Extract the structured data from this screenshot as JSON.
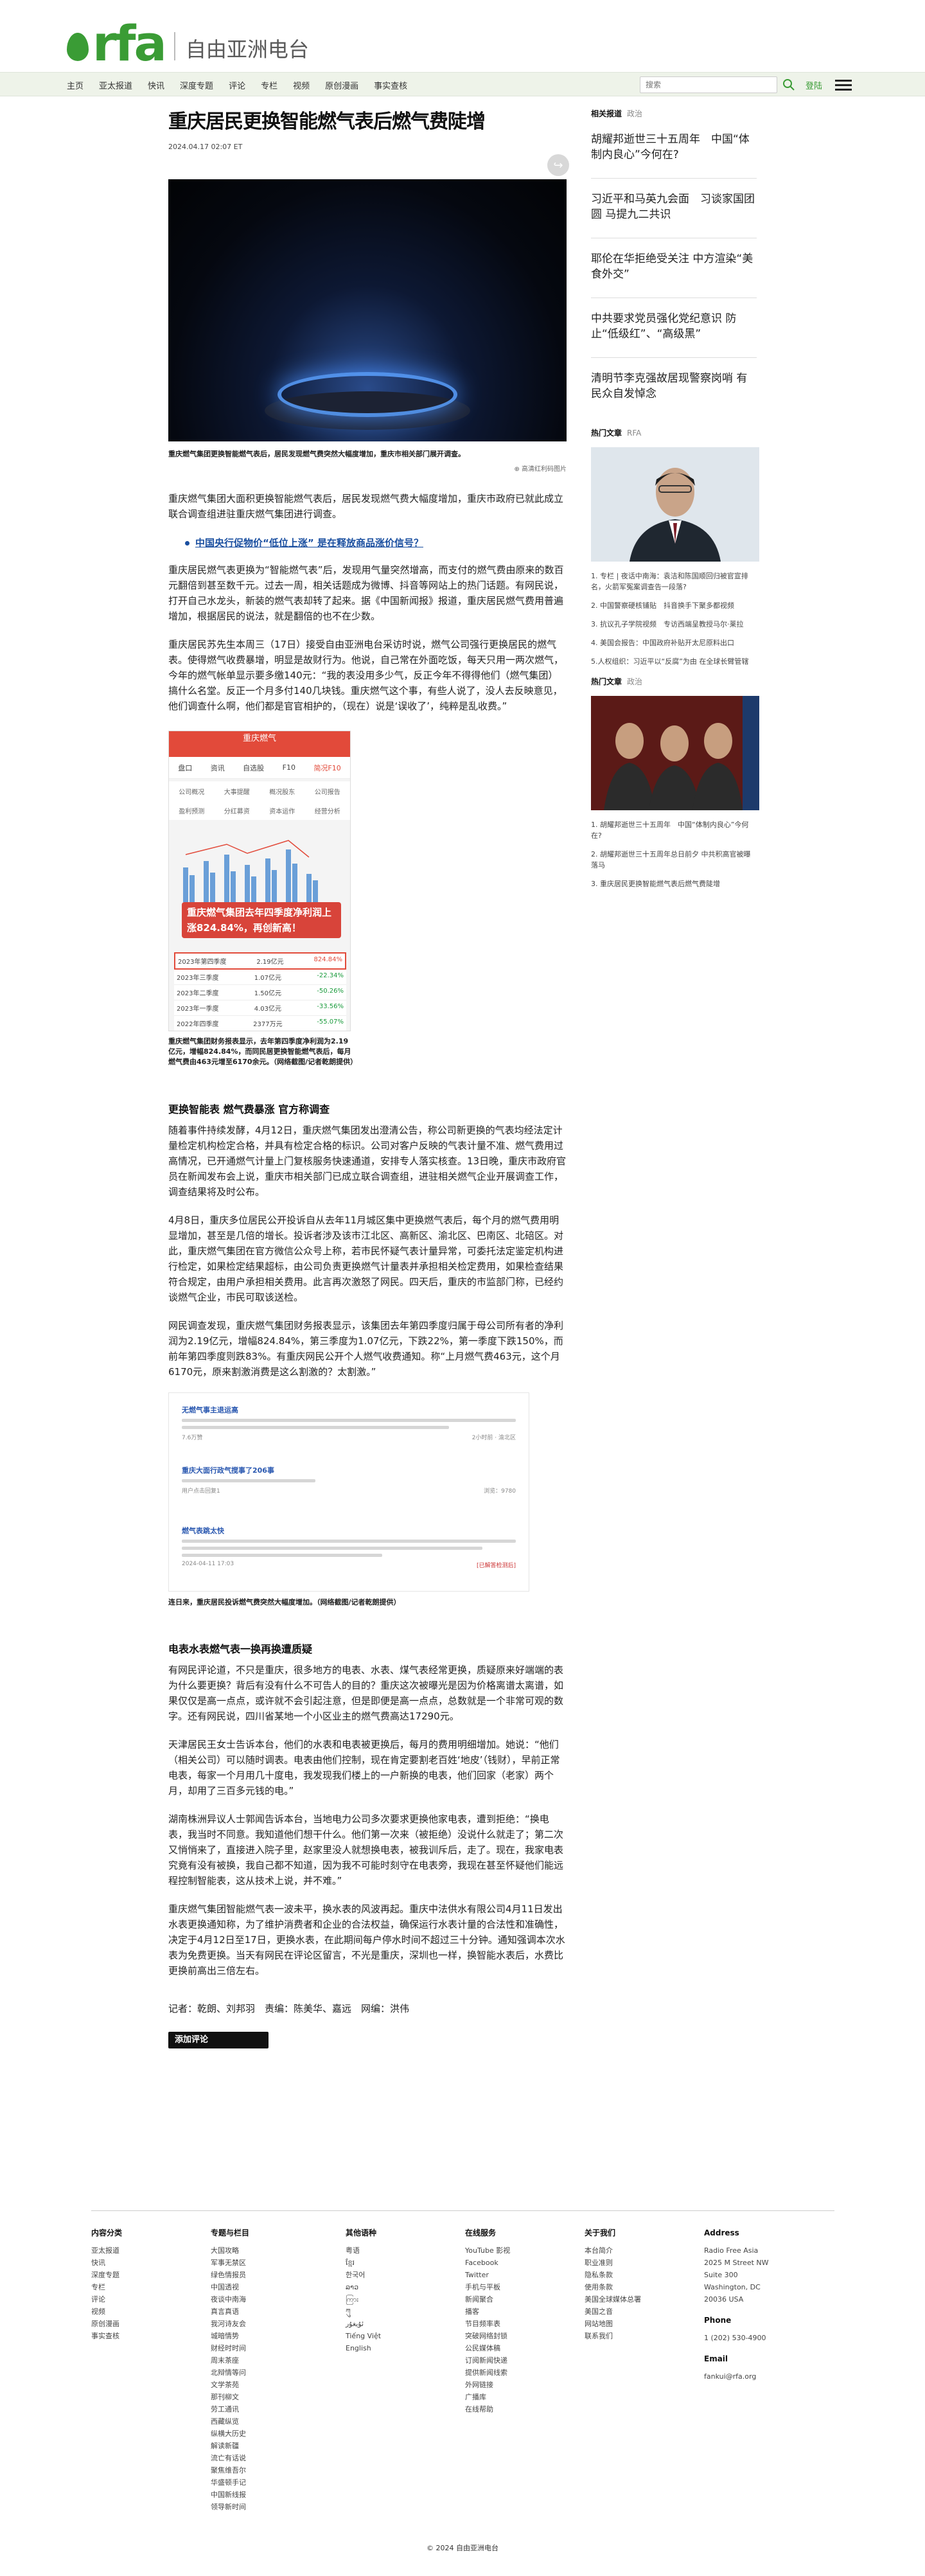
{
  "header": {
    "logo_text": "rfa",
    "logo_cn": "自由亚洲电台",
    "nav": [
      "主页",
      "亚太报道",
      "快讯",
      "深度专题",
      "评论",
      "专栏",
      "视频",
      "原创漫画",
      "事实查核"
    ],
    "search_placeholder": "搜索",
    "login": "登陆"
  },
  "article": {
    "title": "重庆居民更换智能燃气表后燃气费陡增",
    "date": "2024.04.17 02:07 ET",
    "hero_caption": "重庆燃气集团更换智能燃气表后，居民发现燃气费突然大幅度增加，重庆市相关部门展开调查。",
    "enlarge_label": "高清红利码图片",
    "p1": "重庆燃气集团大面积更换智能燃气表后，居民发现燃气费大幅度增加，重庆市政府已就此成立联合调查组进驻重庆燃气集团进行调查。",
    "related_link": "中国央行促物价“低位上涨” 是在释放商品涨价信号？",
    "p2": "重庆居民燃气表更换为“智能燃气表”后，发现用气量突然增高，而支付的燃气费由原来的数百元翻倍到甚至数千元。过去一周，相关话题成为微博、抖音等网站上的热门话题。有网民说，打开自己水龙头，新装的燃气表却转了起来。据《中国新闻报》报道，重庆居民燃气费用普遍增加，根据居民的说法，就是翻倍的也不在少数。",
    "p3": "重庆居民苏先生本周三（17日）接受自由亚洲电台采访时说，燃气公司强行更换居民的燃气表。使得燃气收费暴增，明显是故财行为。他说，自己常在外面吃饭，每天只用一两次燃气，今年的燃气帐单显示要多缴140元：“我的表没用多少气，反正今年不得得他们（燃气集团）搞什么名堂。反正一个月多付140几块钱。重庆燃气这个事，有些人说了，没人去反映意见，他们调查什么啊，他们都是官官相护的，（现在）说是‘误收了’，纯粹是乱收费。”",
    "app": {
      "header": "重庆燃气",
      "tabs": [
        "盘口",
        "资讯",
        "自选股",
        "F10",
        "简况F10"
      ],
      "grid": [
        "公司概况",
        "大事提醒",
        "概况股东",
        "公司报告",
        "盈利预测",
        "分红募资",
        "资本运作",
        "经营分析"
      ],
      "banner": "重庆燃气集团去年四季度净利润上涨824.84%，再创新高！",
      "rows": [
        {
          "label": "2023年第四季度",
          "v1": "2.19亿元",
          "v2": "824.84%"
        },
        {
          "label": "2023年三季度",
          "v1": "1.07亿元",
          "v2": "-22.34%"
        },
        {
          "label": "2023年二季度",
          "v1": "1.50亿元",
          "v2": "-50.26%"
        },
        {
          "label": "2023年一季度",
          "v1": "4.03亿元",
          "v2": "-33.56%"
        },
        {
          "label": "2022年四季度",
          "v1": "2377万元",
          "v2": "-55.07%"
        }
      ]
    },
    "app_caption": "重庆燃气集团财务报表显示，去年第四季度净利润为2.19亿元，增幅824.84%，而同民居更换智能燃气表后，每月燃气费由463元增至6170余元。（网络截图/记者乾朗提供）",
    "section1": "更换智能表 燃气费暴涨 官方称调查",
    "p4": "随着事件持续发酵，4月12日，重庆燃气集团发出澄清公告，称公司新更换的气表均经法定计量检定机构检定合格，并具有检定合格的标识。公司对客户反映的气表计量不准、燃气费用过高情况，已开通燃气计量上门复核服务快速通道，安排专人落实核查。13日晚，重庆市政府官员在新闻发布会上说，重庆市相关部门已成立联合调查组，进驻相关燃气企业开展调查工作，调查结果将及时公布。",
    "p5": "4月8日，重庆多位居民公开投诉自从去年11月城区集中更换燃气表后，每个月的燃气费用明显增加，甚至是几倍的增长。投诉者涉及该市江北区、高新区、渝北区、巴南区、北碚区。对此，重庆燃气集团在官方微信公众号上称，若市民怀疑气表计量异常，可委托法定鉴定机构进行检定，如果检定结果超标，由公司负责更换燃气计量表并承担相关检定费用，如果检查结果符合规定，由用户承担相关费用。此言再次激怒了网民。四天后，重庆的市监部门称，已经约谈燃气企业，市民可取该送检。",
    "p6": "网民调查发现，重庆燃气集团财务报表显示，该集团去年第四季度归属于母公司所有者的净利润为2.19亿元，增幅824.84%，第三季度为1.07亿元，下跌22%，第一季度下跌150%，而前年第四季度则跌83%。有重庆网民公开个人燃气收费通知。称“上月燃气费463元，这个月6170元，原来割激消费是这么割激的？太割激。”",
    "web": {
      "items": [
        {
          "title": "无燃气事主退运高",
          "meta_l": "7.6万赞",
          "meta_r": "2小时前 · 渝北区"
        },
        {
          "title": "重庆大面行政气搅事了206事",
          "meta_l": "用户点击回复1",
          "meta_r": "浏览：9780"
        },
        {
          "title": "燃气表跳太快",
          "meta_l": "2024-04-11 17:03",
          "meta_r": "[已解答检测后]"
        }
      ]
    },
    "web_caption": "连日来，重庆居民投诉燃气费突然大幅度增加。（网络截图/记者乾朗提供）",
    "section2": "电表水表燃气表一换再换遭质疑",
    "p7": "有网民评论道，不只是重庆，很多地方的电表、水表、煤气表经常更换，质疑原来好端端的表为什么要更换？背后有没有什么不可告人的目的？重庆这次被曝光是因为价格离谱太离谱，如果仅仅是高一点点，或许就不会引起注意，但是即便是高一点点，总数就是一个非常可观的数字。还有网民说，四川省某地一个小区业主的燃气费高达17290元。",
    "p8": "天津居民王女士告诉本台，他们的水表和电表被更换后，每月的费用明细增加。她说：“他们（相关公司）可以随时调表。电表由他们控制，现在肯定要割老百姓‘地皮’（钱财），早前正常电表，每家一个月用几十度电，我发现我们楼上的一户新换的电表，他们回家（老家）两个月，却用了三百多元钱的电。”",
    "p9": "湖南株洲异议人士郭闻告诉本台，当地电力公司多次要求更换他家电表，遭到拒绝：“换电表，我当时不同意。我知道他们想干什么。他们第一次来（被拒绝）没说什么就走了；第二次又悄悄来了，直接进入院子里，赵家里没人就想换电表，被我训斥后，走了。现在，我家电表究竟有没有被换，我自己都不知道，因为我不可能时刻守在电表旁，我现在甚至怀疑他们能远程控制智能表，这从技术上说，并不难。”",
    "p10": "重庆燃气集团智能燃气表一波未平，换水表的风波再起。重庆中法供水有限公司4月11日发出水表更换通知称，为了维护消费者和企业的合法权益，确保运行水表计量的合法性和准确性，决定于4月12日至17日，更换水表，在此期间每户停水时间不超过三十分钟。通知强调本次水表为免费更换。当天有网民在评论区留言，不光是重庆，深圳也一样，换智能水表后，水费比更换前高出三倍左右。",
    "byline": "记者：乾朗、刘邦羽　责编：陈美华、嘉远　网编：洪伟",
    "comment_btn": "添加评论"
  },
  "sidebar": {
    "head1": "相关报道",
    "head1_cat": "政治",
    "related": [
      "胡耀邦逝世三十五周年　中国“体制内良心”今何在?",
      "习近平和马英九会面　习谈家国团圆 马提九二共识",
      "耶伦在华拒绝受关注 中方渲染“美食外交”",
      "中共要求党员强化党纪意识 防止“低级红”、“高级黑”",
      "清明节李克强故居现警察岗哨 有民众自发悼念"
    ],
    "head2": "热门文章",
    "head2_cat": "RFA",
    "hot1": [
      "1. 专栏 | 夜话中南海：袁洁和陈国顺回归被官宣排名，火箭军冤案调查告一段落?",
      "2. 中国警察硬核铺贴　抖音换手下聚多都视频",
      "3. 抗议孔子学院视频　专访西端呈教授马尔·莱拉",
      "4. 美国会报告：中国政府补贴开太尼原料出口",
      "5.人权组织：习近平以“反腐”为由 在全球长臂管辖"
    ],
    "head3": "热门文章",
    "head3_cat": "政治",
    "hot2": [
      "1. 胡耀邦逝世三十五周年　中国“体制内良心”今何在?",
      "2. 胡耀邦逝世三十五周年总日前夕 中共积高官被曝落马",
      "3. 重庆居民更换智能燃气表后燃气费陡增"
    ]
  },
  "footer": {
    "cols": [
      {
        "title": "内容分类",
        "items": [
          "亚太报道",
          "快讯",
          "深度专题",
          "专栏",
          "评论",
          "视频",
          "原创漫画",
          "事实查核"
        ]
      },
      {
        "title": "专题与栏目",
        "items": [
          "大国攻略",
          "军事无禁区",
          "绿色情报员",
          "中国透视",
          "夜谈中南海",
          "真言真语",
          "我河诗友会",
          "城暗情势",
          "财经时时间",
          "周末茶座",
          "北辩情等问",
          "文学茶苑",
          "那刊柳文",
          "劳工通讯",
          "西藏纵览",
          "纵横大历史",
          "解读新疆",
          "流亡有话说",
          "聚焦维吾尔",
          "华盛顿手记",
          "中国新线报",
          "领导新时间"
        ]
      },
      {
        "title": "其他语种",
        "items": [
          "粤语",
          "ខ្មែរ",
          "한국어",
          "ລາວ",
          "ကြား",
          "ཀུ",
          "ئۇيغۇر",
          "Tiếng Việt",
          "English"
        ]
      },
      {
        "title": "在线服务",
        "items": [
          "YouTube 影视",
          "Facebook",
          "Twitter",
          "手机与平板",
          "新闻聚合",
          "播客",
          "节目频率表",
          "突破网络封锁",
          "公民媒体稿",
          "订阅新闻快递",
          "提供新闻线索",
          "外网链接",
          "广播库",
          "在线帮助"
        ]
      },
      {
        "title": "关于我们",
        "items": [
          "本台简介",
          "职业准则",
          "隐私条款",
          "使用条款",
          "美国全球媒体总署",
          "美国之音",
          "网站地图",
          "联系我们"
        ]
      }
    ],
    "address": {
      "title": "Address",
      "lines": [
        "Radio Free Asia",
        "2025 M Street NW",
        "Suite 300",
        "Washington, DC",
        "20036 USA"
      ]
    },
    "phone": {
      "title": "Phone",
      "value": "1 (202) 530-4900"
    },
    "email": {
      "title": "Email",
      "value": "fankui@rfa.org"
    },
    "copyright": "© 2024 自由亚洲电台"
  }
}
